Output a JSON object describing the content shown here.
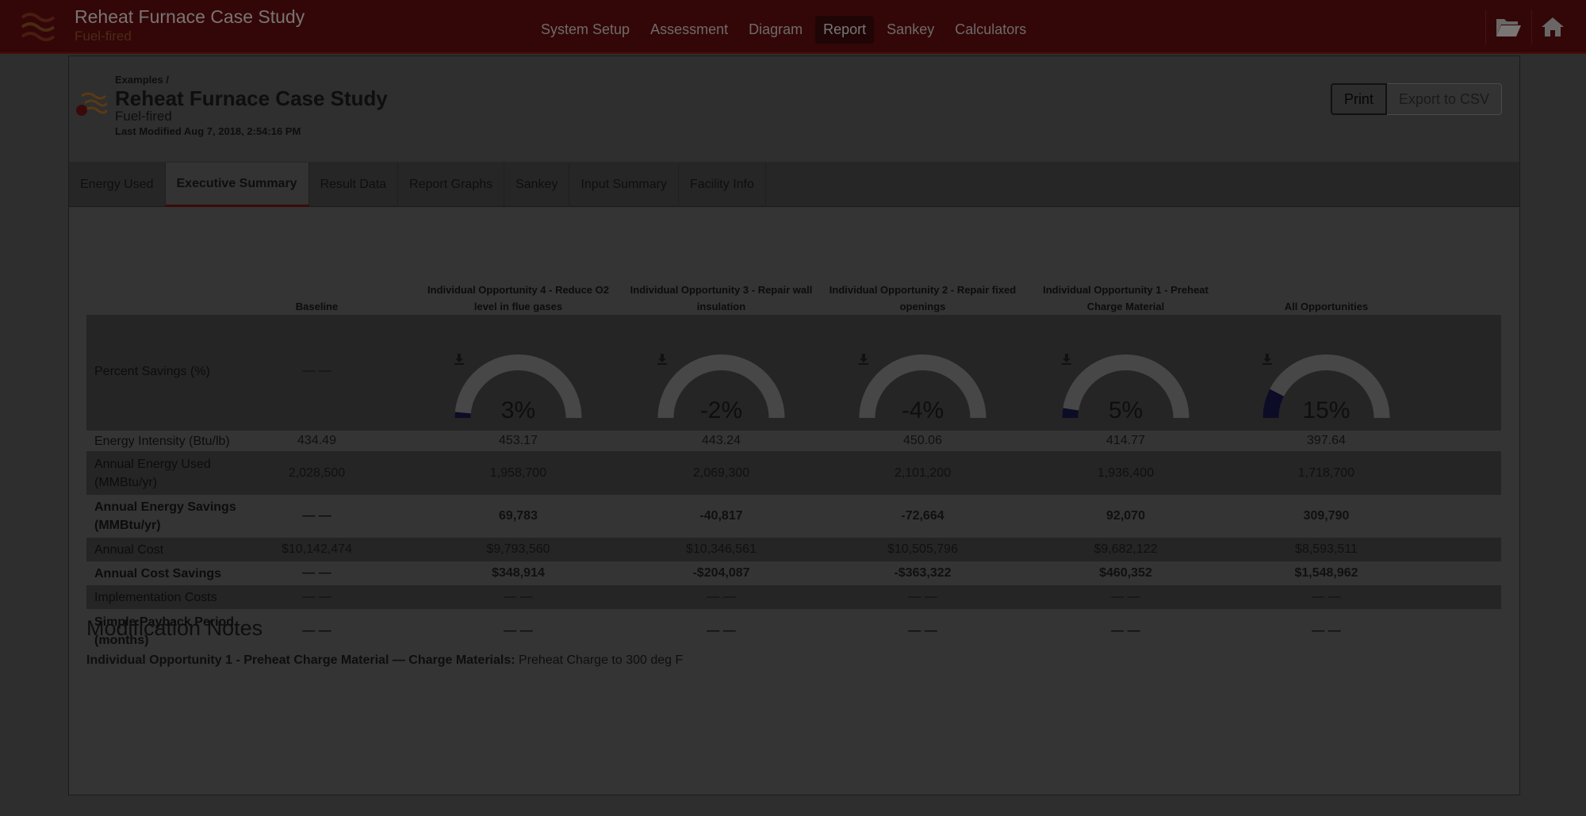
{
  "app": {
    "title": "Reheat Furnace Case Study",
    "subtitle": "Fuel-fired"
  },
  "nav": [
    "System Setup",
    "Assessment",
    "Diagram",
    "Report",
    "Sankey",
    "Calculators"
  ],
  "nav_active": "Report",
  "header": {
    "breadcrumb": "Examples /",
    "title": "Reheat Furnace Case Study",
    "subtitle": "Fuel-fired",
    "last_modified": "Last Modified Aug 7, 2018, 2:54:16 PM",
    "print_label": "Print",
    "export_label": "Export to CSV"
  },
  "tabs": [
    "Energy Used",
    "Executive Summary",
    "Result Data",
    "Report Graphs",
    "Sankey",
    "Input Summary",
    "Facility Info"
  ],
  "tab_active": "Executive Summary",
  "columns": [
    "Baseline",
    "Individual Opportunity 4 - Reduce O2 level in flue gases",
    "Individual Opportunity 3 - Repair wall insulation",
    "Individual Opportunity 2 - Repair fixed openings",
    "Individual Opportunity 1 - Preheat Charge Material",
    "All Opportunities"
  ],
  "percent_savings": {
    "label": "Percent Savings (%)",
    "baseline": "— —",
    "values": [
      3,
      -2,
      -4,
      5,
      15
    ],
    "display": [
      "3%",
      "-2%",
      "-4%",
      "5%",
      "15%"
    ]
  },
  "rows": [
    {
      "label": "Energy Intensity (Btu/lb)",
      "values": [
        "434.49",
        "453.17",
        "443.24",
        "450.06",
        "414.77",
        "397.64"
      ],
      "bold": false,
      "dark": false
    },
    {
      "label": "Annual Energy Used (MMBtu/yr)",
      "values": [
        "2,028,500",
        "1,958,700",
        "2,069,300",
        "2,101,200",
        "1,936,400",
        "1,718,700"
      ],
      "bold": false,
      "dark": true
    },
    {
      "label": "Annual Energy Savings (MMBtu/yr)",
      "values": [
        "— —",
        "69,783",
        "-40,817",
        "-72,664",
        "92,070",
        "309,790"
      ],
      "bold": true,
      "dark": false
    },
    {
      "label": "Annual Cost",
      "values": [
        "$10,142,474",
        "$9,793,560",
        "$10,346,561",
        "$10,505,796",
        "$9,682,122",
        "$8,593,511"
      ],
      "bold": false,
      "dark": true
    },
    {
      "label": "Annual Cost Savings",
      "values": [
        "— —",
        "$348,914",
        "-$204,087",
        "-$363,322",
        "$460,352",
        "$1,548,962"
      ],
      "bold": true,
      "dark": false
    },
    {
      "label": "Implementation Costs",
      "values": [
        "— —",
        "— —",
        "— —",
        "— —",
        "— —",
        "— —"
      ],
      "bold": false,
      "dark": true
    },
    {
      "label": "Simple Payback Period (months)",
      "values": [
        "— —",
        "— —",
        "— —",
        "— —",
        "— —",
        "— —"
      ],
      "bold": true,
      "dark": false
    }
  ],
  "notes": {
    "title": "Modification Notes",
    "label": "Individual Opportunity 1 - Preheat Charge Material — Charge Materials:",
    "text": "Preheat Charge to 300 deg F"
  },
  "colors": {
    "topbar": "#330707",
    "gauge_track": "#474747",
    "gauge_fill": "#0c0c26"
  }
}
